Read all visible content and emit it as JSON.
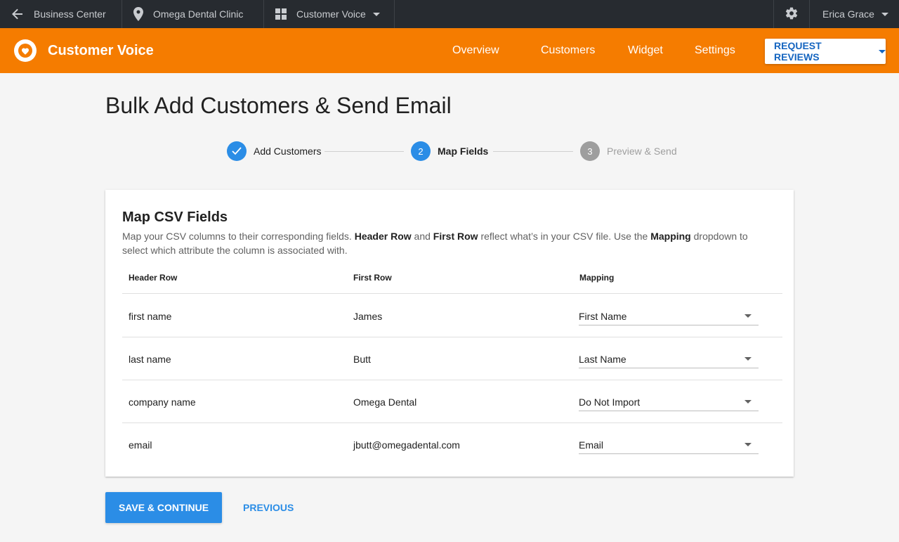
{
  "topbar": {
    "back_label": "Business Center",
    "location_label": "Omega Dental Clinic",
    "product_label": "Customer Voice",
    "user_name": "Erica Grace"
  },
  "appbar": {
    "title": "Customer Voice",
    "nav": [
      "Overview",
      "Customers",
      "Widget",
      "Settings"
    ],
    "request_button": "REQUEST REVIEWS",
    "accent_color": "#f57c00"
  },
  "page": {
    "title": "Bulk Add Customers & Send Email"
  },
  "stepper": {
    "steps": [
      {
        "number": "",
        "label": "Add Customers",
        "state": "complete"
      },
      {
        "number": "2",
        "label": "Map Fields",
        "state": "active"
      },
      {
        "number": "3",
        "label": "Preview & Send",
        "state": "inactive"
      }
    ]
  },
  "card": {
    "title": "Map CSV Fields",
    "desc": {
      "p1": "Map your CSV columns to their corresponding fields. ",
      "b1": "Header Row",
      "p2": " and ",
      "b2": "First Row",
      "p3": " reflect what’s in your CSV file. Use the ",
      "b3": "Mapping",
      "p4": " dropdown to select which attribute the column is associated with."
    },
    "columns": [
      "Header Row",
      "First Row",
      "Mapping"
    ],
    "rows": [
      {
        "header": "first name",
        "first": "James",
        "mapping": "First Name"
      },
      {
        "header": "last name",
        "first": "Butt",
        "mapping": "Last Name"
      },
      {
        "header": "company name",
        "first": "Omega Dental",
        "mapping": "Do Not Import"
      },
      {
        "header": "email",
        "first": "jbutt@omegadental.com",
        "mapping": "Email"
      }
    ]
  },
  "actions": {
    "save": "SAVE & CONTINUE",
    "previous": "PREVIOUS"
  }
}
